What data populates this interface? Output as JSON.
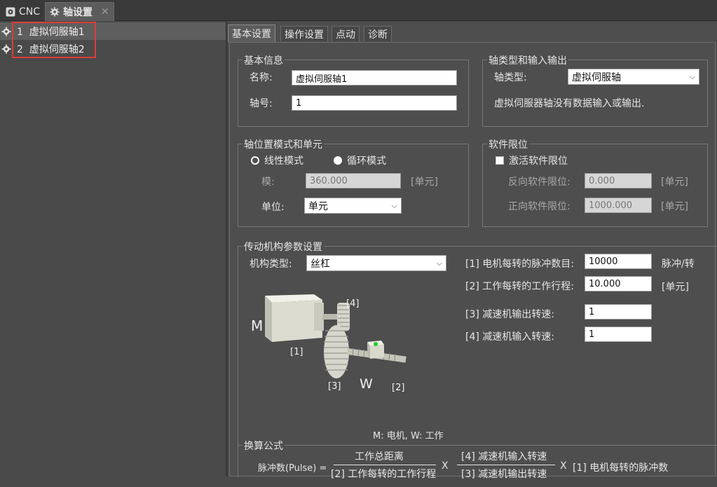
{
  "doc_tabs": [
    {
      "label": "CNC"
    },
    {
      "label": "轴设置",
      "close": "✕"
    }
  ],
  "tree": {
    "items": [
      {
        "label": "1  虚拟伺服轴1"
      },
      {
        "label": "2  虚拟伺服轴2"
      }
    ]
  },
  "content_tabs": [
    {
      "label": "基本设置"
    },
    {
      "label": "操作设置"
    },
    {
      "label": "点动"
    },
    {
      "label": "诊断"
    }
  ],
  "basic_info": {
    "title": "基本信息",
    "name_label": "名称:",
    "name_value": "虚拟伺服轴1",
    "axis_no_label": "轴号:",
    "axis_no_value": "1"
  },
  "axis_type": {
    "title": "轴类型和输入输出",
    "type_label": "轴类型:",
    "type_value": "虚拟伺服轴",
    "note": "虚拟伺服器轴没有数据输入或输出."
  },
  "position_mode": {
    "title": "轴位置模式和单元",
    "linear_label": "线性模式",
    "cyclic_label": "循环模式",
    "selected": "cyclic",
    "modulus_label": "模:",
    "modulus_value": "360.000",
    "modulus_unit": "[单元]",
    "unit_label": "单位:",
    "unit_value": "单元"
  },
  "soft_limits": {
    "title": "软件限位",
    "activate_label": "激活软件限位",
    "activated": false,
    "reverse_label": "反向软件限位:",
    "reverse_value": "0.000",
    "reverse_unit": "[单元]",
    "forward_label": "正向软件限位:",
    "forward_value": "1000.000",
    "forward_unit": "[单元]"
  },
  "transmission": {
    "title": "传动机构参数设置",
    "mech_type_label": "机构类型:",
    "mech_type_value": "丝杠",
    "params": [
      {
        "label": "[1] 电机每转的脉冲数目:",
        "value": "10000",
        "unit": "脉冲/转"
      },
      {
        "label": "[2] 工作每转的工作行程:",
        "value": "10.000",
        "unit": "[单元]"
      },
      {
        "label": "[3] 减速机输出转速:",
        "value": "1",
        "unit": ""
      },
      {
        "label": "[4] 减速机输入转速:",
        "value": "1",
        "unit": ""
      }
    ],
    "diagram": {
      "motor_letter": "M",
      "work_letter": "W",
      "tag1": "[1]",
      "tag2": "[2]",
      "tag3": "[3]",
      "tag4": "[4]",
      "legend": "M: 电机, W: 工作"
    }
  },
  "formula": {
    "title": "换算公式",
    "lhs": "脉冲数(Pulse) =",
    "frac1_num": "工作总距离",
    "frac1_den": "[2] 工作每转的工作行程",
    "times1": "X",
    "frac2_num": "[4] 减速机输入转速",
    "frac2_den": "[3] 减速机输出转速",
    "times2": "X",
    "tail": "[1] 电机每转的脉冲数"
  },
  "colors": {
    "highlight": "#e03a3a",
    "background": "#4a4a4a",
    "indicator_green": "#22cc22"
  }
}
